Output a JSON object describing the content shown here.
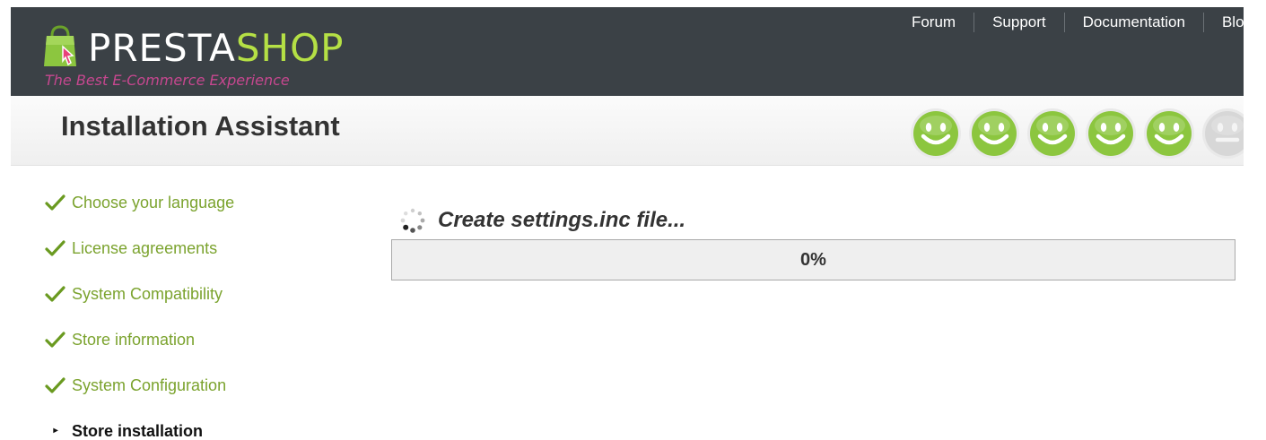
{
  "header": {
    "logo": {
      "name_part1": "PRESTA",
      "name_part2": "SHOP",
      "tagline": "The Best E-Commerce Experience"
    },
    "nav": [
      {
        "label": "Forum"
      },
      {
        "label": "Support"
      },
      {
        "label": "Documentation"
      },
      {
        "label": "Blog"
      }
    ]
  },
  "title_band": {
    "title": "Installation Assistant",
    "smileys": [
      {
        "state": "done",
        "color": "#8cc63f",
        "icon": "smiley-icon"
      },
      {
        "state": "done",
        "color": "#8cc63f",
        "icon": "smiley-icon"
      },
      {
        "state": "done",
        "color": "#8cc63f",
        "icon": "smiley-icon"
      },
      {
        "state": "done",
        "color": "#8cc63f",
        "icon": "smiley-icon"
      },
      {
        "state": "done",
        "color": "#8cc63f",
        "icon": "smiley-icon"
      },
      {
        "state": "pending",
        "color": "#d7d7d7",
        "icon": "smiley-icon"
      }
    ]
  },
  "steps": [
    {
      "label": "Choose your language",
      "status": "done",
      "icon": "check-icon"
    },
    {
      "label": "License agreements",
      "status": "done",
      "icon": "check-icon"
    },
    {
      "label": "System Compatibility",
      "status": "done",
      "icon": "check-icon"
    },
    {
      "label": "Store information",
      "status": "done",
      "icon": "check-icon"
    },
    {
      "label": "System Configuration",
      "status": "done",
      "icon": "check-icon"
    },
    {
      "label": "Store installation",
      "status": "current",
      "icon": "triangle-right-icon"
    }
  ],
  "main": {
    "progress_title": "Create settings.inc file...",
    "progress_percent_label": "0%",
    "progress_fraction": 0
  },
  "colors": {
    "header_bg": "#3b4146",
    "accent_green": "#8cc63f",
    "step_green": "#7ba32e",
    "tagline_pink": "#c6478f",
    "logo_green": "#b5e045"
  }
}
